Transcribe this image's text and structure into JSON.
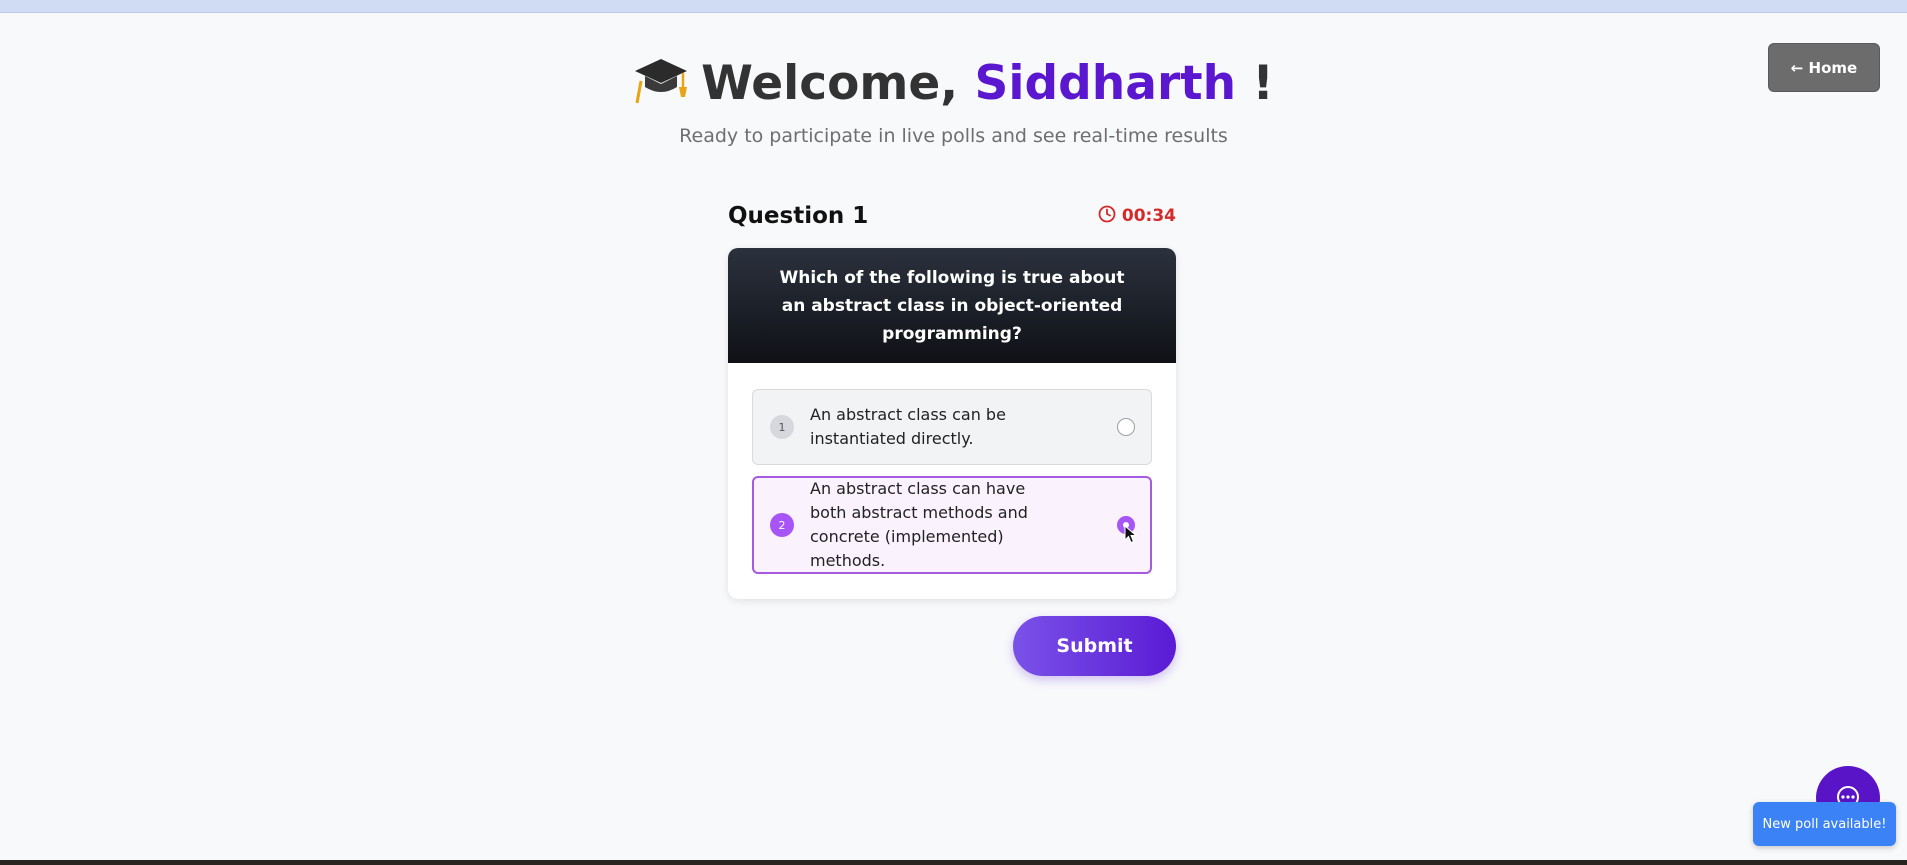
{
  "header": {
    "greeting": "Welcome,",
    "user_name": "Siddharth",
    "exclaim": "!",
    "subtitle": "Ready to participate in live polls and see real-time results",
    "home_label": "← Home"
  },
  "question": {
    "label": "Question 1",
    "timer": "00:34",
    "text": "Which of the following is true about an abstract class in object-oriented programming?",
    "options": [
      {
        "number": "1",
        "text": "An abstract class can be instantiated directly.",
        "selected": false
      },
      {
        "number": "2",
        "text": "An abstract class can have both abstract methods and concrete (implemented) methods.",
        "selected": true
      }
    ],
    "submit_label": "Submit"
  },
  "notification": {
    "toast_text": "New poll available!"
  },
  "icons": {
    "title": "graduation-cap-icon",
    "timer": "clock-icon",
    "chat": "chat-icon"
  },
  "colors": {
    "accent": "#5b16cf",
    "selected": "#a855f7",
    "timer": "#d42a2a",
    "toast": "#3b82f6"
  }
}
